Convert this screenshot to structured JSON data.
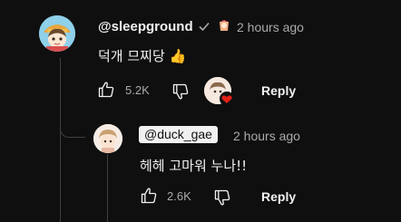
{
  "comment": {
    "author": "@sleepground",
    "time": "2 hours ago",
    "text": "덕개 므찌당 👍",
    "likes": "5.2K",
    "reply_label": "Reply"
  },
  "reply_comment": {
    "author": "@duck_gae",
    "time": "2 hours ago",
    "text": "헤헤 고마워 누나!!",
    "likes": "2.6K",
    "reply_label": "Reply"
  },
  "icons": {
    "like": "thumbs-up-icon",
    "dislike": "thumbs-down-icon",
    "verified": "check-icon",
    "badge": "creator-badge-icon",
    "hearted": "creator-heart-icon"
  },
  "colors": {
    "background": "#0f0f0f",
    "text": "#f1f1f1",
    "secondary": "#aaaaaa",
    "heart": "#e62117"
  }
}
